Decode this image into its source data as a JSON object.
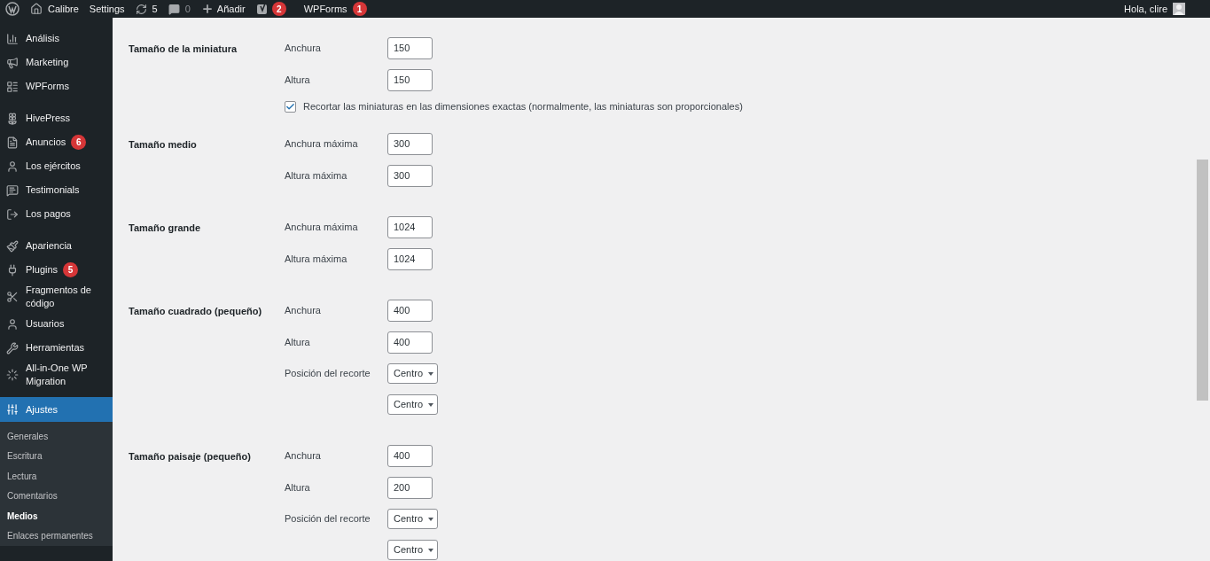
{
  "admin_bar": {
    "site": "Calibre",
    "settings": "Settings",
    "updates": "5",
    "comments": "0",
    "add": "Añadir",
    "yoast_badge": "2",
    "wpforms": "WPForms",
    "wpforms_badge": "1",
    "greeting": "Hola, clire"
  },
  "sidebar": {
    "groups": [
      [
        {
          "label": "Análisis"
        },
        {
          "label": "Marketing"
        },
        {
          "label": "WPForms"
        }
      ],
      [
        {
          "label": "HivePress"
        },
        {
          "label": "Anuncios",
          "badge": "6"
        },
        {
          "label": "Los ejércitos"
        },
        {
          "label": "Testimonials"
        },
        {
          "label": "Los pagos"
        }
      ],
      [
        {
          "label": "Apariencia"
        },
        {
          "label": "Plugins",
          "badge": "5"
        },
        {
          "label": "Fragmentos de código"
        },
        {
          "label": "Usuarios"
        },
        {
          "label": "Herramientas"
        },
        {
          "label": "All-in-One WP Migration"
        }
      ]
    ],
    "active": {
      "label": "Ajustes",
      "selected": true,
      "submenu": [
        {
          "label": "Generales",
          "selected": false
        },
        {
          "label": "Escritura",
          "selected": false
        },
        {
          "label": "Lectura",
          "selected": false
        },
        {
          "label": "Comentarios",
          "selected": false
        },
        {
          "label": "Medios",
          "selected": true
        },
        {
          "label": "Enlaces permanentes",
          "selected": false
        }
      ]
    }
  },
  "sections": [
    {
      "title": "Tamaño de la miniatura",
      "rows": [
        {
          "kind": "input",
          "label": "Anchura",
          "value": "150"
        },
        {
          "kind": "input",
          "label": "Altura",
          "value": "150"
        },
        {
          "kind": "checkbox",
          "label": "Recortar las miniaturas en las dimensiones exactas (normalmente, las miniaturas son proporcionales)",
          "checked": true
        }
      ]
    },
    {
      "title": "Tamaño medio",
      "rows": [
        {
          "kind": "input",
          "label": "Anchura máxima",
          "value": "300"
        },
        {
          "kind": "input",
          "label": "Altura máxima",
          "value": "300"
        }
      ]
    },
    {
      "title": "Tamaño grande",
      "rows": [
        {
          "kind": "input",
          "label": "Anchura máxima",
          "value": "1024"
        },
        {
          "kind": "input",
          "label": "Altura máxima",
          "value": "1024"
        }
      ]
    },
    {
      "title": "Tamaño cuadrado (pequeño)",
      "rows": [
        {
          "kind": "input",
          "label": "Anchura",
          "value": "400"
        },
        {
          "kind": "input",
          "label": "Altura",
          "value": "400"
        },
        {
          "kind": "select",
          "label": "Posición del recorte",
          "value": "Centro"
        },
        {
          "kind": "select",
          "value": "Centro"
        }
      ]
    },
    {
      "title": "Tamaño paisaje (pequeño)",
      "rows": [
        {
          "kind": "input",
          "label": "Anchura",
          "value": "400"
        },
        {
          "kind": "input",
          "label": "Altura",
          "value": "200"
        },
        {
          "kind": "select",
          "label": "Posición del recorte",
          "value": "Centro"
        },
        {
          "kind": "select",
          "value": "Centro"
        }
      ]
    }
  ]
}
